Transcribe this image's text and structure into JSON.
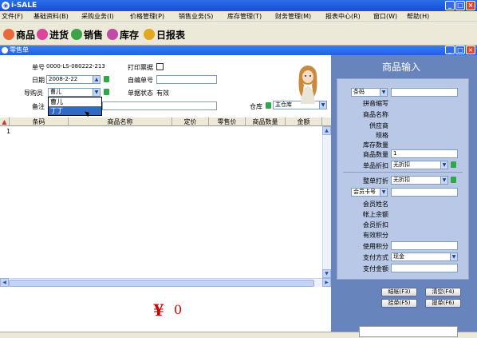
{
  "window": {
    "title": "i-SALE"
  },
  "menu": [
    "文件(F)",
    "基础资料(B)",
    "采购业务(I)",
    "价格管理(P)",
    "销售业务(S)",
    "库存管理(T)",
    "财务管理(M)",
    "报表中心(R)",
    "窗口(W)",
    "帮助(H)"
  ],
  "toolbar": [
    "商品",
    "进货",
    "销售",
    "库存",
    "日报表"
  ],
  "subwindow": {
    "title": "零售单"
  },
  "form": {
    "order_no_label": "单号",
    "order_no_value": "0000-LS-080222-213",
    "print_label": "打印票据",
    "date_label": "日期",
    "date_value": "2008-2-22",
    "custom_no_label": "自编单号",
    "guide_label": "导购员",
    "guide_value": "曹儿",
    "status_label": "单据状态",
    "status_value": "有效",
    "note_label": "备注",
    "warehouse_label": "仓库",
    "warehouse_value": "主仓库"
  },
  "guide_dropdown": [
    "曹儿",
    "丁丁"
  ],
  "grid": {
    "headers": [
      "条码",
      "商品名称",
      "定价",
      "零售价",
      "商品数量",
      "金额"
    ],
    "rows": [
      "1"
    ]
  },
  "total": {
    "currency": "¥",
    "amount": "0"
  },
  "right_panel": {
    "title": "商品输入",
    "barcode_select": "条码",
    "labels": [
      "拼音缩写",
      "商品名称",
      "供应商",
      "规格",
      "库存数量",
      "商品数量",
      "单品折扣"
    ],
    "qty_value": "1",
    "discount_value": "无折扣",
    "whole_discount_label": "整单打折",
    "whole_discount_value": "无折扣",
    "member_select": "会员卡号",
    "member_labels": [
      "会员姓名",
      "帐上余额",
      "会员折扣",
      "有效积分",
      "使用积分",
      "支付方式",
      "支付金额"
    ],
    "pay_method_value": "现金",
    "buttons": [
      "结帐(F3)",
      "清空(F4)",
      "挂单(F5)",
      "提单(F6)"
    ]
  }
}
